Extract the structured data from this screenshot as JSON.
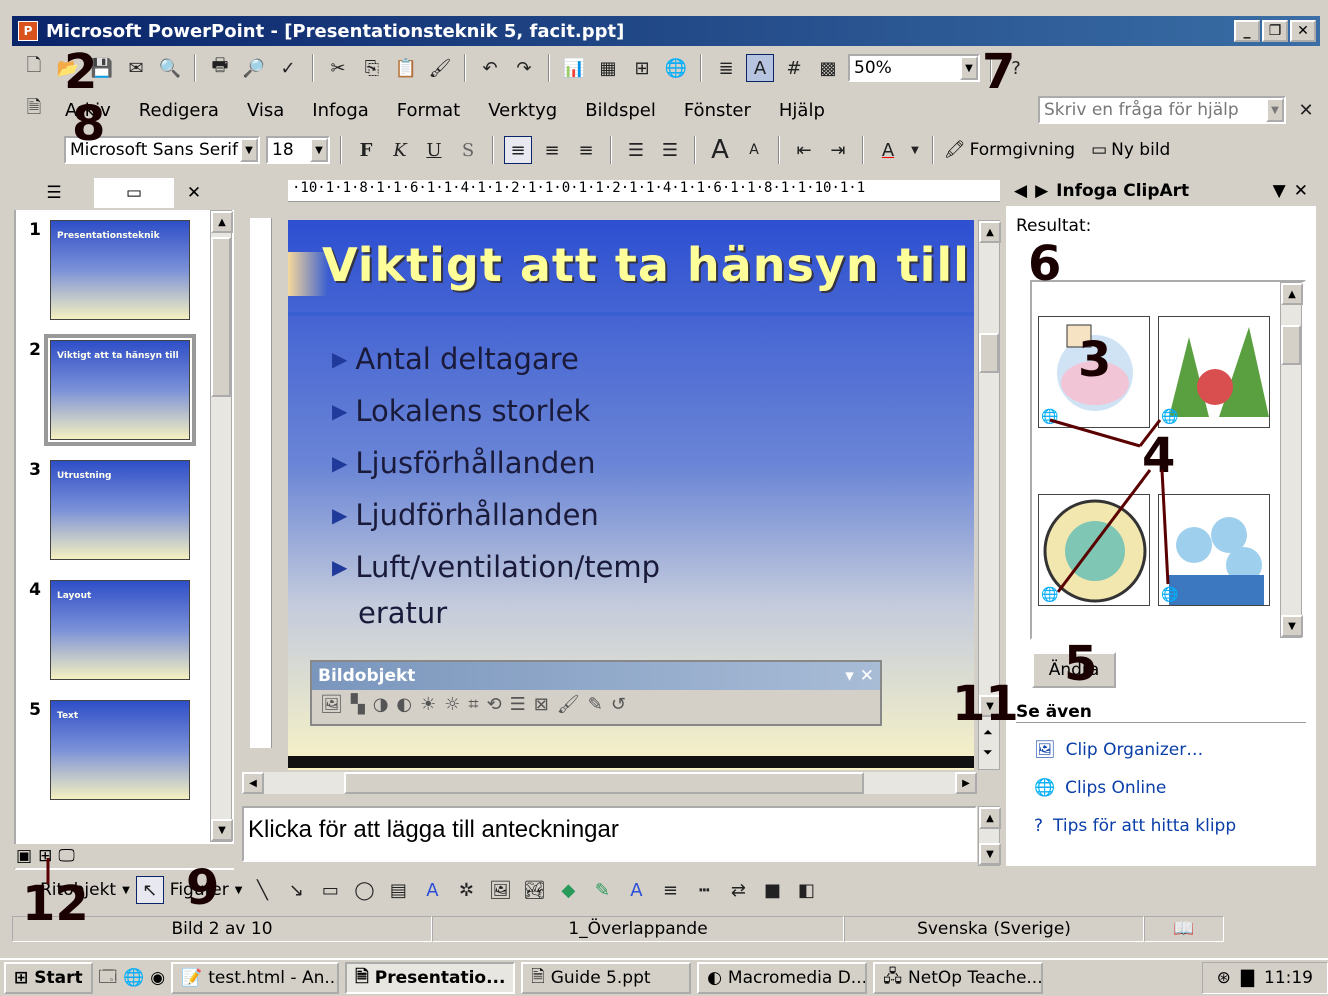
{
  "window": {
    "title": "Microsoft PowerPoint - [Presentationsteknik 5, facit.ppt]"
  },
  "menu": [
    "Arkiv",
    "Redigera",
    "Visa",
    "Infoga",
    "Format",
    "Verktyg",
    "Bildspel",
    "Fönster",
    "Hjälp"
  ],
  "help_box": {
    "placeholder": "Skriv en fråga för hjälp"
  },
  "zoom": "50%",
  "format_toolbar": {
    "font": "Microsoft Sans Serif",
    "size": "18",
    "bold": "F",
    "italic": "K",
    "underline": "U",
    "shadow": "S",
    "design": "Formgivning",
    "new_slide": "Ny bild"
  },
  "thumbnails": [
    {
      "num": "1",
      "label": "Presentationsteknik"
    },
    {
      "num": "2",
      "label": "Viktigt att ta hänsyn till"
    },
    {
      "num": "3",
      "label": "Utrustning"
    },
    {
      "num": "4",
      "label": "Layout"
    },
    {
      "num": "5",
      "label": "Text"
    }
  ],
  "ruler": "·10·1·1·8·1·1·6·1·1·4·1·1·2·1·1·0·1·1·2·1·1·4·1·1·6·1·1·8·1·1·10·1·1",
  "slide": {
    "title": "Viktigt att ta hänsyn till",
    "bullets": [
      "Antal deltagare",
      "Lokalens storlek",
      "Ljusförhållanden",
      "Ljudförhållanden",
      "Luft/ventilation/temp"
    ],
    "bullet_cont": "eratur"
  },
  "picture_toolbar": {
    "title": "Bildobjekt"
  },
  "notes": {
    "placeholder": "Klicka för att lägga till anteckningar"
  },
  "taskpane": {
    "title": "Infoga ClipArt",
    "results_label": "Resultat:",
    "modify_button": "Ändra",
    "see_also": "Se även",
    "links": [
      "Clip Organizer…",
      "Clips Online",
      "Tips för att hitta klipp"
    ]
  },
  "drawing_toolbar": {
    "draw": "Ritobjekt",
    "autoshapes": "Figurer"
  },
  "status": {
    "slide": "Bild 2 av 10",
    "design": "1_Överlappande",
    "language": "Svenska (Sverige)"
  },
  "taskbar": {
    "start": "Start",
    "items": [
      "test.html - An...",
      "Presentatio...",
      "Guide 5.ppt",
      "Macromedia D...",
      "NetOp Teache..."
    ],
    "clock": "11:19"
  },
  "annotations": [
    "2",
    "7",
    "8",
    "6",
    "3",
    "4",
    "5",
    "11",
    "9",
    "12"
  ]
}
